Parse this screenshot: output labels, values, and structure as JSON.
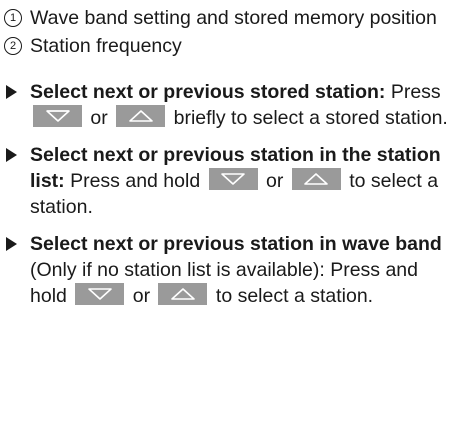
{
  "legend": [
    {
      "num": "1",
      "text": "Wave band setting and stored memory position"
    },
    {
      "num": "2",
      "text": "Station frequency"
    }
  ],
  "steps": [
    {
      "title": "Select next or previous stored station:",
      "part1": " Press",
      "or": "or",
      "part2": "briefly to select a stored station."
    },
    {
      "title": "Select next or previous station in the station list:",
      "part1": " Press and hold",
      "or": "or",
      "part2": "to select a station."
    },
    {
      "title": "Select next or previous station in wave band",
      "note": " (Only if no station list is available): Press and hold",
      "or": "or",
      "part2": "to select a station."
    }
  ],
  "icons": {
    "down_key": "down-arrow-key",
    "up_key": "up-arrow-key"
  },
  "colors": {
    "key_background": "#9a9a9a",
    "key_arrow": "#ffffff"
  }
}
